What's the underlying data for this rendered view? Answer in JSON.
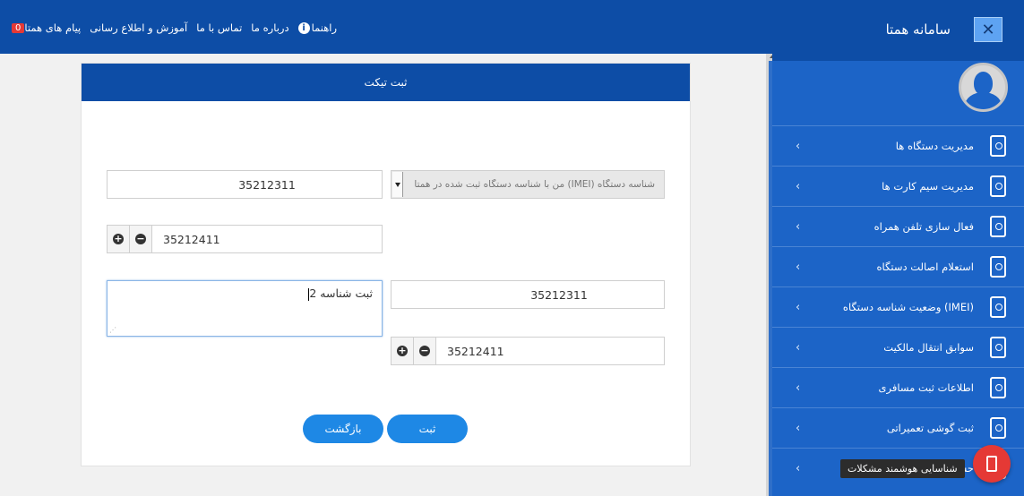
{
  "topnav": {
    "help": "راهنما",
    "about": "درباره ما",
    "contact": "تماس با ما",
    "education": "آموزش و اطلاع رسانی",
    "messages": "پیام های همتا",
    "messages_badge": "0"
  },
  "sidebar": {
    "app_title": "سامانه همتا",
    "close_glyph": "✕",
    "items": [
      {
        "label": "مدیریت دستگاه ها",
        "icon": "phone-settings-icon"
      },
      {
        "label": "مدیریت سیم کارت ها",
        "icon": "sim-card-icon"
      },
      {
        "label": "فعال سازی تلفن همراه",
        "icon": "phone-activate-icon"
      },
      {
        "label": "استعلام اصالت دستگاه",
        "icon": "phone-search-icon"
      },
      {
        "label": "وضعیت شناسه دستگاه (IMEI)",
        "icon": "phone-status-icon"
      },
      {
        "label": "سوابق انتقال مالکیت",
        "icon": "ownership-transfer-icon"
      },
      {
        "label": "اطلاعات ثبت مسافری",
        "icon": "traveler-info-icon"
      },
      {
        "label": "ثبت گوشی تعمیراتی",
        "icon": "repair-icon"
      },
      {
        "label": "حساب کاربری",
        "icon": "user-account-icon"
      }
    ],
    "fab_tooltip": "شناسایی هوشمند مشکلات"
  },
  "card": {
    "title": "ثبت تیکت",
    "select_placeholder": "شناسه دستگاه (IMEI) من با شناسه دستگاه ثبت شده در همتا",
    "imei_1": "35212311",
    "stepper_1": "35212411",
    "imei_2": "35212311",
    "stepper_2": "35212411",
    "textarea_value": "ثبت شناسه 2",
    "submit_label": "ثبت",
    "back_label": "بازگشت"
  },
  "colors": {
    "primary": "#0d4da6",
    "sidebar": "#1c64c7",
    "button": "#1e88e5",
    "danger": "#e53935"
  }
}
